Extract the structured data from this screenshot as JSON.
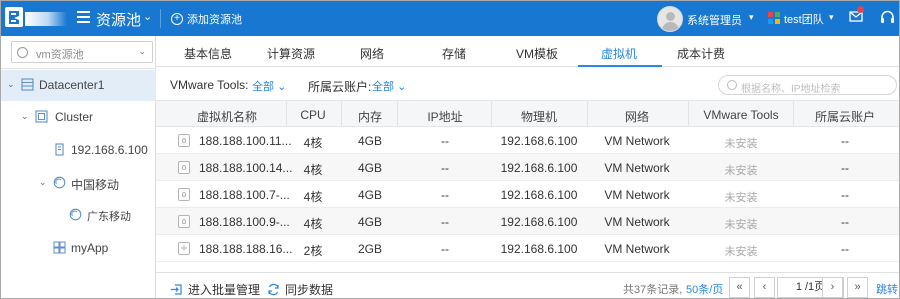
{
  "header": {
    "title": "资源池",
    "add_pool_label": "添加资源池",
    "user_name": "系统管理员",
    "team_name": "test团队",
    "colors": {
      "bar": "#1777d1",
      "accent": "#2a86e8"
    }
  },
  "sidebar": {
    "pool_select": {
      "value": "vm资源池"
    },
    "tree": [
      {
        "label": "Datacenter1",
        "icon": "datacenter-icon",
        "expanded": true,
        "selected": true
      },
      {
        "label": "Cluster",
        "icon": "cluster-icon",
        "expanded": true
      },
      {
        "label": "192.168.6.100",
        "icon": "host-icon"
      },
      {
        "label": "中国移动",
        "icon": "resource-pool-icon",
        "expanded": true
      },
      {
        "label": "广东移动",
        "icon": "resource-pool-icon"
      },
      {
        "label": "myApp",
        "icon": "vapp-icon"
      }
    ]
  },
  "tabs": [
    {
      "label": "基本信息"
    },
    {
      "label": "计算资源"
    },
    {
      "label": "网络"
    },
    {
      "label": "存储"
    },
    {
      "label": "VM模板"
    },
    {
      "label": "虚拟机",
      "active": true
    },
    {
      "label": "成本计费"
    }
  ],
  "filters": {
    "tools_label": "VMware Tools:",
    "tools_value": "全部",
    "account_label": "所属云账户:",
    "account_value": "全部",
    "search_placeholder": "根据名称、IP地址检索"
  },
  "table": {
    "columns": [
      "虚拟机名称",
      "CPU",
      "内存",
      "IP地址",
      "物理机",
      "网络",
      "VMware Tools",
      "所属云账户"
    ],
    "rows": [
      {
        "os": "linux",
        "name": "188.188.100.11...",
        "cpu": "4核",
        "mem": "4GB",
        "ip": "--",
        "host": "192.168.6.100",
        "net": "VM Network",
        "tools": "未安装",
        "account": "--"
      },
      {
        "os": "linux",
        "name": "188.188.100.14...",
        "cpu": "4核",
        "mem": "4GB",
        "ip": "--",
        "host": "192.168.6.100",
        "net": "VM Network",
        "tools": "未安装",
        "account": "--"
      },
      {
        "os": "linux",
        "name": "188.188.100.7-...",
        "cpu": "4核",
        "mem": "4GB",
        "ip": "--",
        "host": "192.168.6.100",
        "net": "VM Network",
        "tools": "未安装",
        "account": "--"
      },
      {
        "os": "linux",
        "name": "188.188.100.9-...",
        "cpu": "4核",
        "mem": "4GB",
        "ip": "--",
        "host": "192.168.6.100",
        "net": "VM Network",
        "tools": "未安装",
        "account": "--"
      },
      {
        "os": "windows",
        "name": "188.188.188.16...",
        "cpu": "2核",
        "mem": "2GB",
        "ip": "--",
        "host": "192.168.6.100",
        "net": "VM Network",
        "tools": "未安装",
        "account": "--"
      }
    ]
  },
  "footer": {
    "batch_label": "进入批量管理",
    "sync_label": "同步数据",
    "total_text": "共37条记录,",
    "per_page": "50条/页",
    "page_text": "1 /1页",
    "jump_label": "跳转",
    "first": "«",
    "prev": "‹",
    "next": "›",
    "last": "»"
  }
}
